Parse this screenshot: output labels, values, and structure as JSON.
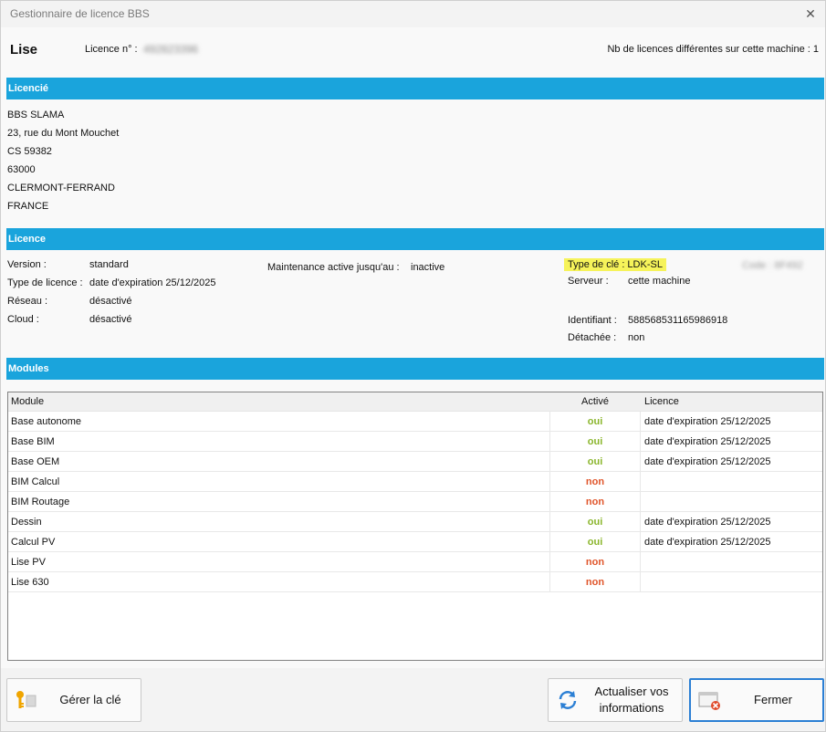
{
  "window": {
    "title": "Gestionnaire de licence BBS",
    "close_symbol": "✕"
  },
  "header": {
    "app_name": "Lise",
    "licence_label": "Licence n° :",
    "licence_value": "492823396",
    "nb_licences": "Nb de licences différentes sur cette machine : 1"
  },
  "licencie": {
    "title": "Licencié",
    "lines": [
      "BBS SLAMA",
      "23, rue du Mont Mouchet",
      "CS 59382",
      "63000",
      "CLERMONT-FERRAND",
      "FRANCE"
    ]
  },
  "licence": {
    "title": "Licence",
    "version_label": "Version :",
    "version_value": "standard",
    "type_label": "Type de licence :",
    "type_value": "date d'expiration 25/12/2025",
    "reseau_label": "Réseau :",
    "reseau_value": "désactivé",
    "cloud_label": "Cloud :",
    "cloud_value": "désactivé",
    "maintenance_label": "Maintenance active jusqu'au :",
    "maintenance_value": "inactive",
    "type_cle": "Type de clé : LDK-SL",
    "code": "Code : 8F492",
    "serveur_label": "Serveur :",
    "serveur_value": "cette machine",
    "identifiant_label": "Identifiant :",
    "identifiant_value": "588568531165986918",
    "detachee_label": "Détachée :",
    "detachee_value": "non"
  },
  "modules": {
    "title": "Modules",
    "columns": [
      "Module",
      "Activé",
      "Licence"
    ],
    "rows": [
      {
        "module": "Base autonome",
        "active": "oui",
        "licence": "date d'expiration 25/12/2025"
      },
      {
        "module": "Base BIM",
        "active": "oui",
        "licence": "date d'expiration 25/12/2025"
      },
      {
        "module": "Base OEM",
        "active": "oui",
        "licence": "date d'expiration 25/12/2025"
      },
      {
        "module": "BIM Calcul",
        "active": "non",
        "licence": ""
      },
      {
        "module": "BIM Routage",
        "active": "non",
        "licence": ""
      },
      {
        "module": "Dessin",
        "active": "oui",
        "licence": "date d'expiration 25/12/2025"
      },
      {
        "module": "Calcul PV",
        "active": "oui",
        "licence": "date d'expiration 25/12/2025"
      },
      {
        "module": "Lise PV",
        "active": "non",
        "licence": ""
      },
      {
        "module": "Lise 630",
        "active": "non",
        "licence": ""
      }
    ]
  },
  "footer": {
    "manage_key": "Gérer la clé",
    "update_info_line1": "Actualiser vos",
    "update_info_line2": "informations",
    "close": "Fermer"
  },
  "colors": {
    "band": "#1aa4dc",
    "oui": "#8ab52c",
    "non": "#e0552a",
    "highlight": "#f6f35a"
  }
}
